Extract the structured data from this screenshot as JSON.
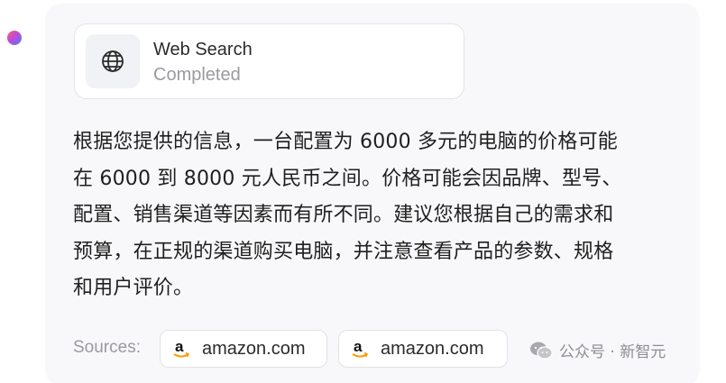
{
  "tool": {
    "name": "Web Search",
    "status": "Completed",
    "icon": "globe-icon"
  },
  "answer": {
    "lines": [
      "根据您提供的信息，一台配置为 6000 多元的电脑的价格可能",
      "在 6000 到 8000 元人民币之间。价格可能会因品牌、型号、",
      "配置、销售渠道等因素而有所不同。建议您根据自己的需求和",
      "预算，在正规的渠道购买电脑，并注意查看产品的参数、规格",
      "和用户评价。"
    ]
  },
  "sources": {
    "label": "Sources:",
    "items": [
      {
        "domain": "amazon.com",
        "icon": "amazon-icon"
      },
      {
        "domain": "amazon.com",
        "icon": "amazon-icon"
      }
    ]
  },
  "watermark": {
    "text": "公众号 · 新智元",
    "icon": "wechat-icon"
  },
  "colors": {
    "bubble_bg": "#f8f8fa",
    "card_border": "#e4e4e8",
    "muted_text": "#9a9aa0",
    "amazon_orange": "#ff9900"
  }
}
